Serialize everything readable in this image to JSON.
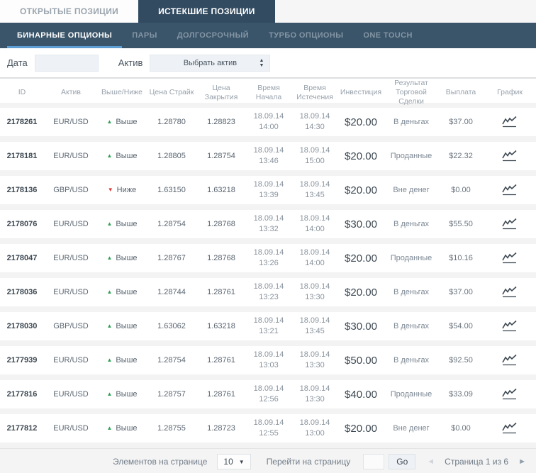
{
  "tabs": {
    "open": "ОТКРЫТЫЕ ПОЗИЦИИ",
    "expired": "ИСТЕКШИЕ ПОЗИЦИИ"
  },
  "nav": {
    "items": [
      {
        "label": "БИНАРНЫЕ ОПЦИОНЫ",
        "active": true
      },
      {
        "label": "ПАРЫ",
        "active": false
      },
      {
        "label": "ДОЛГОСРОЧНЫЙ",
        "active": false
      },
      {
        "label": "ТУРБО ОПЦИОНЫ",
        "active": false
      },
      {
        "label": "ONE TOUCH",
        "active": false
      }
    ]
  },
  "filters": {
    "date_label": "Дата",
    "date_value": "",
    "asset_label": "Актив",
    "asset_selected": "Выбрать актив"
  },
  "table": {
    "headers": [
      "ID",
      "Актив",
      "Выше/Ниже",
      "Цена Страйк",
      "Цена Закрытия",
      "Время Начала",
      "Время Истечения",
      "Инвестиция",
      "Результат Торговой Сделки",
      "Выплата",
      "График"
    ],
    "rows": [
      {
        "id": "2178261",
        "asset": "EUR/USD",
        "direction": "up",
        "direction_label": "Выше",
        "strike": "1.28780",
        "close_price": "1.28823",
        "start_date": "18.09.14",
        "start_time": "14:00",
        "expiry_date": "18.09.14",
        "expiry_time": "14:30",
        "investment": "$20.00",
        "result": "В деньгах",
        "payout": "$37.00"
      },
      {
        "id": "2178181",
        "asset": "EUR/USD",
        "direction": "up",
        "direction_label": "Выше",
        "strike": "1.28805",
        "close_price": "1.28754",
        "start_date": "18.09.14",
        "start_time": "13:46",
        "expiry_date": "18.09.14",
        "expiry_time": "15:00",
        "investment": "$20.00",
        "result": "Проданные",
        "payout": "$22.32"
      },
      {
        "id": "2178136",
        "asset": "GBP/USD",
        "direction": "down",
        "direction_label": "Ниже",
        "strike": "1.63150",
        "close_price": "1.63218",
        "start_date": "18.09.14",
        "start_time": "13:39",
        "expiry_date": "18.09.14",
        "expiry_time": "13:45",
        "investment": "$20.00",
        "result": "Вне денег",
        "payout": "$0.00"
      },
      {
        "id": "2178076",
        "asset": "EUR/USD",
        "direction": "up",
        "direction_label": "Выше",
        "strike": "1.28754",
        "close_price": "1.28768",
        "start_date": "18.09.14",
        "start_time": "13:32",
        "expiry_date": "18.09.14",
        "expiry_time": "14:00",
        "investment": "$30.00",
        "result": "В деньгах",
        "payout": "$55.50"
      },
      {
        "id": "2178047",
        "asset": "EUR/USD",
        "direction": "up",
        "direction_label": "Выше",
        "strike": "1.28767",
        "close_price": "1.28768",
        "start_date": "18.09.14",
        "start_time": "13:26",
        "expiry_date": "18.09.14",
        "expiry_time": "14:00",
        "investment": "$20.00",
        "result": "Проданные",
        "payout": "$10.16"
      },
      {
        "id": "2178036",
        "asset": "EUR/USD",
        "direction": "up",
        "direction_label": "Выше",
        "strike": "1.28744",
        "close_price": "1.28761",
        "start_date": "18.09.14",
        "start_time": "13:23",
        "expiry_date": "18.09.14",
        "expiry_time": "13:30",
        "investment": "$20.00",
        "result": "В деньгах",
        "payout": "$37.00"
      },
      {
        "id": "2178030",
        "asset": "GBP/USD",
        "direction": "up",
        "direction_label": "Выше",
        "strike": "1.63062",
        "close_price": "1.63218",
        "start_date": "18.09.14",
        "start_time": "13:21",
        "expiry_date": "18.09.14",
        "expiry_time": "13:45",
        "investment": "$30.00",
        "result": "В деньгах",
        "payout": "$54.00"
      },
      {
        "id": "2177939",
        "asset": "EUR/USD",
        "direction": "up",
        "direction_label": "Выше",
        "strike": "1.28754",
        "close_price": "1.28761",
        "start_date": "18.09.14",
        "start_time": "13:03",
        "expiry_date": "18.09.14",
        "expiry_time": "13:30",
        "investment": "$50.00",
        "result": "В деньгах",
        "payout": "$92.50"
      },
      {
        "id": "2177816",
        "asset": "EUR/USD",
        "direction": "up",
        "direction_label": "Выше",
        "strike": "1.28757",
        "close_price": "1.28761",
        "start_date": "18.09.14",
        "start_time": "12:56",
        "expiry_date": "18.09.14",
        "expiry_time": "13:30",
        "investment": "$40.00",
        "result": "Проданные",
        "payout": "$33.09"
      },
      {
        "id": "2177812",
        "asset": "EUR/USD",
        "direction": "up",
        "direction_label": "Выше",
        "strike": "1.28755",
        "close_price": "1.28723",
        "start_date": "18.09.14",
        "start_time": "12:55",
        "expiry_date": "18.09.14",
        "expiry_time": "13:00",
        "investment": "$20.00",
        "result": "Вне денег",
        "payout": "$0.00"
      }
    ]
  },
  "footer": {
    "items_per_page_label": "Элементов на странице",
    "items_per_page_value": "10",
    "goto_label": "Перейти на страницу",
    "goto_value": "",
    "go_button": "Go",
    "page_status": "Страница 1 из 6"
  },
  "colors": {
    "dark_slate": "#3a5469",
    "tab_dark": "#324b61",
    "accent_underline": "#5d9fd4",
    "up_green": "#2fa056",
    "down_red": "#e23939"
  }
}
